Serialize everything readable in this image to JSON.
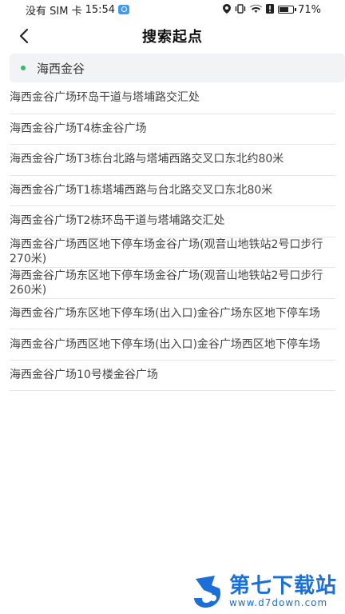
{
  "status_bar": {
    "carrier": "没有 SIM 卡",
    "time": "15:54",
    "battery": "71%"
  },
  "header": {
    "title": "搜索起点"
  },
  "search": {
    "value": "海西金谷"
  },
  "results": [
    "海西金谷广场环岛干道与塔埔路交汇处",
    "海西金谷广场T4栋金谷广场",
    "海西金谷广场T3栋台北路与塔埔西路交叉口东北约80米",
    "海西金谷广场T1栋塔埔西路与台北路交叉口东北80米",
    "海西金谷广场T2栋环岛干道与塔埔路交汇处",
    "海西金谷广场西区地下停车场金谷广场(观音山地铁站2号口步行270米)",
    "海西金谷广场东区地下停车场金谷广场(观音山地铁站2号口步行260米)",
    "海西金谷广场东区地下停车场(出入口)金谷广场东区地下停车场",
    "海西金谷广场西区地下停车场(出入口)金谷广场西区地下停车场",
    "海西金谷广场10号楼金谷广场"
  ],
  "colors": {
    "accent_green": "#2ebd6b",
    "watermark_blue": "#1b6fd6"
  },
  "watermark": {
    "title": "第七下载站",
    "url": "www.d7down.com"
  }
}
